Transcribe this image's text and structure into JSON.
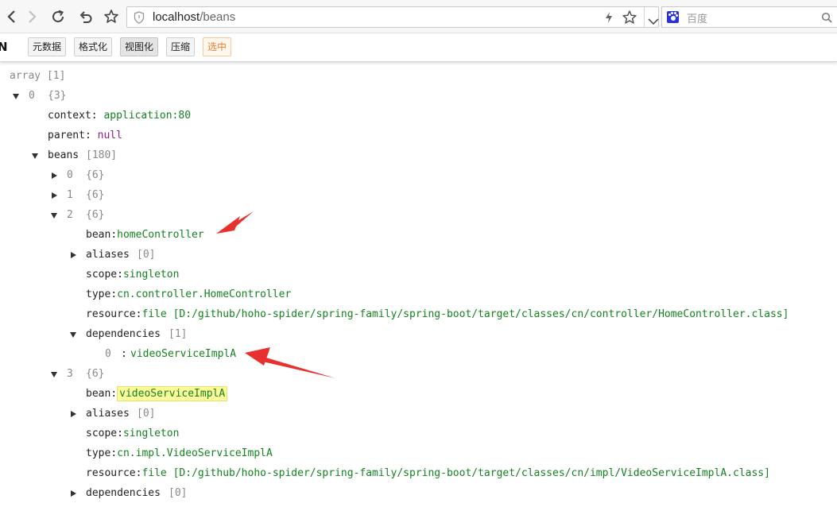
{
  "browser": {
    "address_host": "localhost",
    "address_path": "/beans",
    "search_placeholder": "百度",
    "icons": {
      "back": "back-arrow-icon",
      "forward": "forward-arrow-icon",
      "reload": "reload-icon",
      "undo": "undo-icon",
      "bookmark": "star-icon",
      "shield": "shield-icon",
      "bolt": "lightning-icon",
      "dropdown": "chevron-down-icon",
      "search_engine": "baidu-paw-icon",
      "search": "search-icon"
    }
  },
  "toolbar": {
    "edge_letter": "N",
    "buttons": [
      "元数据",
      "格式化",
      "视图化",
      "压缩",
      "选中"
    ],
    "active_button": "视图化",
    "selected_button": "选中"
  },
  "tree": {
    "root_key": "array",
    "root_meta": "[1]",
    "item0_key": "0",
    "item0_meta": "{3}",
    "context_key": "context",
    "context_value": "application:80",
    "parent_key": "parent",
    "parent_value": "null",
    "beans_key": "beans",
    "beans_meta": "[180]",
    "sep": ":",
    "bean0": {
      "key": "0",
      "meta": "{6}"
    },
    "bean1": {
      "key": "1",
      "meta": "{6}"
    },
    "bean2": {
      "key": "2",
      "meta": "{6}",
      "bean_key": "bean",
      "bean_value": "homeController",
      "aliases_key": "aliases",
      "aliases_meta": "[0]",
      "scope_key": "scope",
      "scope_value": "singleton",
      "type_key": "type",
      "type_value": "cn.controller.HomeController",
      "resource_key": "resource",
      "resource_value": "file [D:/github/hoho-spider/spring-family/spring-boot/target/classes/cn/controller/HomeController.class]",
      "dependencies_key": "dependencies",
      "dependencies_meta": "[1]",
      "dep0_key": "0",
      "dep0_value": "videoServiceImplA"
    },
    "bean3": {
      "key": "3",
      "meta": "{6}",
      "bean_key": "bean",
      "bean_value": "videoServiceImplA",
      "aliases_key": "aliases",
      "aliases_meta": "[0]",
      "scope_key": "scope",
      "scope_value": "singleton",
      "type_key": "type",
      "type_value": "cn.impl.VideoServiceImplA",
      "resource_key": "resource",
      "resource_value": "file [D:/github/hoho-spider/spring-family/spring-boot/target/classes/cn/impl/VideoServiceImplA.class]",
      "dependencies_key": "dependencies",
      "dependencies_meta": "[0]"
    }
  },
  "colors": {
    "string_value": "#14831f",
    "null_value": "#8a1f8a",
    "meta": "#888888",
    "highlight": "#fcfb9c",
    "annotation_arrow": "#e8312f",
    "selected_button": "#e8803a"
  }
}
